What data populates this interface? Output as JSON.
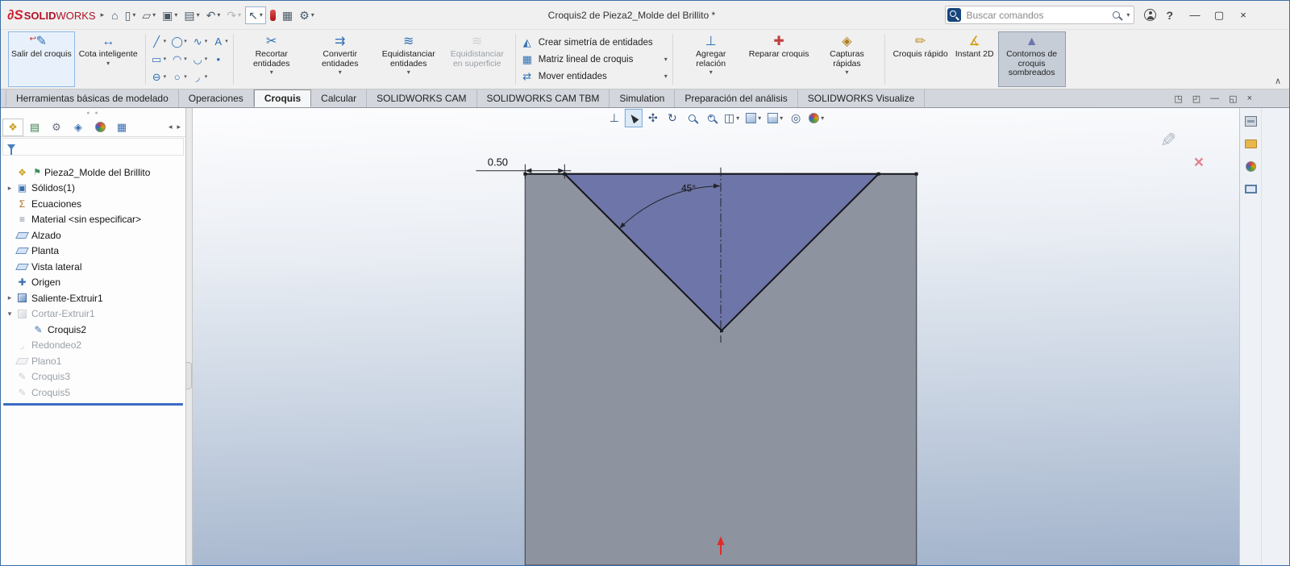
{
  "titlebar": {
    "logo_ds": "∂S",
    "logo_solid": "SOLID",
    "logo_works": "WORKS",
    "expand_arrow": "▸",
    "title": "Croquis2 de Pieza2_Molde del Brillito *",
    "search_placeholder": "Buscar comandos",
    "help_glyph": "?",
    "quick_access": [
      {
        "name": "home-button",
        "glyph": "⌂",
        "dropdown": false
      },
      {
        "name": "new-document-button",
        "glyph": "▯",
        "dropdown": true
      },
      {
        "name": "open-document-button",
        "glyph": "▱",
        "dropdown": true
      },
      {
        "name": "save-button",
        "glyph": "▣",
        "dropdown": true
      },
      {
        "name": "print-button",
        "glyph": "▤",
        "dropdown": true
      },
      {
        "name": "undo-button",
        "glyph": "↶",
        "dropdown": true
      },
      {
        "name": "redo-button",
        "glyph": "↷",
        "dropdown": true,
        "disabled": true
      },
      {
        "name": "select-tool-button",
        "glyph": "↖",
        "dropdown": true,
        "boxed": true
      },
      {
        "name": "red-capsule-icon",
        "css": "i-redpill",
        "dropdown": false
      },
      {
        "name": "evaluate-sheet-button",
        "glyph": "▦",
        "dropdown": false
      },
      {
        "name": "options-button",
        "glyph": "⚙",
        "dropdown": true
      }
    ],
    "window_buttons": [
      {
        "name": "minimize-button",
        "glyph": "—"
      },
      {
        "name": "maximize-button",
        "glyph": "▢"
      },
      {
        "name": "close-button",
        "glyph": "×"
      }
    ]
  },
  "ribbon": {
    "collapse_glyph": "∧",
    "groups": [
      {
        "type": "big",
        "buttons": [
          {
            "label": "Salir del croquis",
            "name": "exit-sketch-button",
            "icon": "exit-sketch",
            "outlined": true
          },
          {
            "label": "Cota inteligente",
            "name": "smart-dimension-button",
            "icon": "smart-dim",
            "dropdown": true
          }
        ]
      },
      {
        "type": "grid",
        "rows": [
          [
            {
              "name": "line-tool",
              "glyph": "╱",
              "dropdown": true
            },
            {
              "name": "circle-tool",
              "glyph": "◯",
              "dropdown": true
            },
            {
              "name": "spline-tool",
              "glyph": "∿",
              "dropdown": true
            },
            {
              "name": "text-tool",
              "glyph": "A",
              "dropdown": true
            }
          ],
          [
            {
              "name": "rectangle-tool",
              "glyph": "▭",
              "dropdown": true
            },
            {
              "name": "arc-tool",
              "glyph": "◠",
              "dropdown": true
            },
            {
              "name": "conic-tool",
              "glyph": "◡",
              "dropdown": true
            },
            {
              "name": "point-tool",
              "glyph": "•",
              "dropdown": false
            }
          ],
          [
            {
              "name": "slot-tool",
              "glyph": "⊖",
              "dropdown": true
            },
            {
              "name": "ellipse-tool",
              "glyph": "○",
              "dropdown": true
            },
            {
              "name": "sketch-fillet-tool",
              "glyph": "◞",
              "dropdown": true
            }
          ]
        ]
      },
      {
        "type": "big",
        "buttons": [
          {
            "label": "Recortar entidades",
            "name": "trim-entities-button",
            "icon": "trim",
            "dropdown": true
          },
          {
            "label": "Convertir entidades",
            "name": "convert-entities-button",
            "icon": "convert",
            "dropdown": true
          },
          {
            "label": "Equidistanciar entidades",
            "name": "offset-entities-button",
            "icon": "offset",
            "dropdown": true
          },
          {
            "label": "Equidistanciar en superficie",
            "name": "offset-on-surface-button",
            "icon": "offset-surf",
            "disabled": true
          }
        ]
      },
      {
        "type": "stack",
        "buttons": [
          {
            "label": "Crear simetría de entidades",
            "name": "mirror-entities-button",
            "icon": "mirror",
            "dropdown": false
          },
          {
            "label": "Matriz lineal de croquis",
            "name": "linear-sketch-pattern-button",
            "icon": "pattern",
            "dropdown": true
          },
          {
            "label": "Mover entidades",
            "name": "move-entities-button",
            "icon": "move",
            "dropdown": true
          }
        ]
      },
      {
        "type": "big",
        "buttons": [
          {
            "label": "Agregar relación",
            "name": "add-relation-button",
            "icon": "relation",
            "dropdown": true
          },
          {
            "label": "Reparar croquis",
            "name": "repair-sketch-button",
            "icon": "repair",
            "dropdown": false
          },
          {
            "label": "Capturas rápidas",
            "name": "quick-snaps-button",
            "icon": "snaps",
            "dropdown": true
          }
        ]
      },
      {
        "type": "big",
        "buttons": [
          {
            "label": "Croquis rápido",
            "name": "rapid-sketch-button",
            "icon": "rapid",
            "dropdown": false
          },
          {
            "label": "Instant 2D",
            "name": "instant2d-button",
            "icon": "instant2d",
            "dropdown": false
          },
          {
            "label": "Contornos de croquis sombreados",
            "name": "shaded-sketch-contours-button",
            "icon": "shaded",
            "active": true,
            "dropdown": false
          }
        ]
      }
    ]
  },
  "command_tabs": {
    "items": [
      {
        "label": "Herramientas básicas de modelado"
      },
      {
        "label": "Operaciones"
      },
      {
        "label": "Croquis",
        "active": true
      },
      {
        "label": "Calcular"
      },
      {
        "label": "SOLIDWORKS CAM"
      },
      {
        "label": "SOLIDWORKS CAM TBM"
      },
      {
        "label": "Simulation"
      },
      {
        "label": "Preparación del análisis"
      },
      {
        "label": "SOLIDWORKS Visualize"
      }
    ],
    "window_buttons": [
      {
        "name": "float-window-icon",
        "glyph": "◳"
      },
      {
        "name": "tile-window-icon",
        "glyph": "◰"
      },
      {
        "name": "minimize-doc-button",
        "glyph": "—"
      },
      {
        "name": "restore-doc-button",
        "glyph": "◱"
      },
      {
        "name": "close-doc-button",
        "glyph": "×"
      }
    ]
  },
  "feature_panel": {
    "tabs": [
      {
        "name": "featuremanager-tab",
        "glyph": "❖",
        "color": "#c9a227",
        "active": true
      },
      {
        "name": "propertymanager-tab",
        "glyph": "▤",
        "color": "#3f7f4f"
      },
      {
        "name": "configurationmanager-tab",
        "glyph": "⚙",
        "color": "#6a7280"
      },
      {
        "name": "dimxpertmanager-tab",
        "glyph": "◈",
        "color": "#3a6fb0"
      },
      {
        "name": "displaymanager-tab",
        "glyph": "ball",
        "color": ""
      },
      {
        "name": "cam-tab",
        "glyph": "▦",
        "color": "#3a6fb0"
      }
    ],
    "scroll_left": "◂",
    "scroll_right": "▸",
    "tree": [
      {
        "label": "Pieza2_Molde del Brillito",
        "icon": "part",
        "icon2": "flag",
        "level": 0
      },
      {
        "label": "Sólidos(1)",
        "icon": "solids",
        "arrow": "right",
        "level": 0
      },
      {
        "label": "Ecuaciones",
        "icon": "equations",
        "level": 0
      },
      {
        "label": "Material <sin especificar>",
        "icon": "material",
        "level": 0
      },
      {
        "label": "Alzado",
        "icon": "plane",
        "level": 0
      },
      {
        "label": "Planta",
        "icon": "plane",
        "level": 0
      },
      {
        "label": "Vista lateral",
        "icon": "plane",
        "level": 0
      },
      {
        "label": "Origen",
        "icon": "origin",
        "level": 0
      },
      {
        "label": "Saliente-Extruir1",
        "icon": "boss",
        "arrow": "right",
        "level": 0
      },
      {
        "label": "Cortar-Extruir1",
        "icon": "cut",
        "arrow": "down",
        "level": 0,
        "grayed": true
      },
      {
        "label": "Croquis2",
        "icon": "sketch-active",
        "level": 1
      },
      {
        "label": "Redondeo2",
        "icon": "fillet",
        "level": 0,
        "grayed": true
      },
      {
        "label": "Plano1",
        "icon": "plane-gray",
        "level": 0,
        "grayed": true
      },
      {
        "label": "Croquis3",
        "icon": "sketch",
        "level": 0,
        "grayed": true
      },
      {
        "label": "Croquis5",
        "icon": "sketch",
        "level": 0,
        "grayed": true
      }
    ]
  },
  "headsup_toolbar": [
    {
      "name": "normal-to-icon",
      "glyph": "⊥"
    },
    {
      "name": "select-cursor-icon",
      "css": "i-cursor",
      "active": true
    },
    {
      "name": "pan-icon",
      "glyph": "✣"
    },
    {
      "name": "rotate-view-icon",
      "glyph": "↻"
    },
    {
      "name": "zoom-icon",
      "css": "i-mag blue"
    },
    {
      "name": "zoom-area-icon",
      "css": "i-mag blue i-magp"
    },
    {
      "name": "section-view-icon",
      "glyph": "◫",
      "dropdown": true
    },
    {
      "name": "view-orientation-icon",
      "css": "i-cube",
      "dropdown": true
    },
    {
      "name": "display-style-icon",
      "css": "i-cube shaded",
      "dropdown": true
    },
    {
      "name": "hide-show-items-icon",
      "glyph": "◎"
    },
    {
      "name": "appearance-icon",
      "css": "i-ball",
      "dropdown": true
    }
  ],
  "task_pane": [
    {
      "name": "solidworks-resources-icon",
      "css": "i-printer"
    },
    {
      "name": "design-library-icon",
      "css": "i-library"
    },
    {
      "name": "appearances-scenes-icon",
      "css": "i-ball"
    },
    {
      "name": "view-palette-icon",
      "css": "i-monitor"
    }
  ],
  "viewport": {
    "linear_dimension": "0.50",
    "angle_dimension": "45°",
    "confirm_sketch_glyph": "✎",
    "confirm_cancel_glyph": "×"
  }
}
